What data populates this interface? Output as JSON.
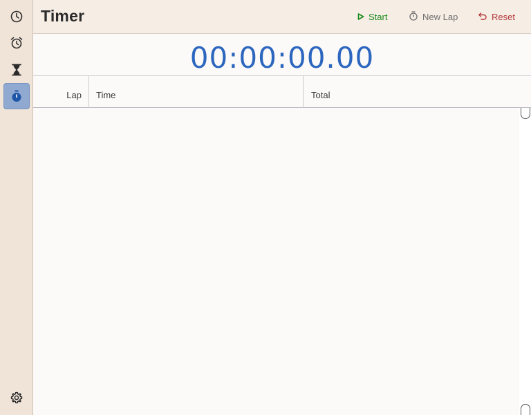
{
  "sidebar": {
    "items": [
      {
        "icon": "clock-icon",
        "active": false
      },
      {
        "icon": "alarm-icon",
        "active": false
      },
      {
        "icon": "hourglass-icon",
        "active": false
      },
      {
        "icon": "stopwatch-icon",
        "active": true
      }
    ],
    "settings_icon": "gear-icon"
  },
  "header": {
    "title": "Timer",
    "start_label": "Start",
    "new_lap_label": "New Lap",
    "reset_label": "Reset"
  },
  "display": {
    "time": "00:00:00.00"
  },
  "table": {
    "columns": [
      "Lap",
      "Time",
      "Total"
    ],
    "rows": []
  },
  "colors": {
    "accent": "#2c66bf",
    "start": "#1a8a1a",
    "reset": "#b33a3a",
    "active_tab": "#8fa9d1"
  }
}
